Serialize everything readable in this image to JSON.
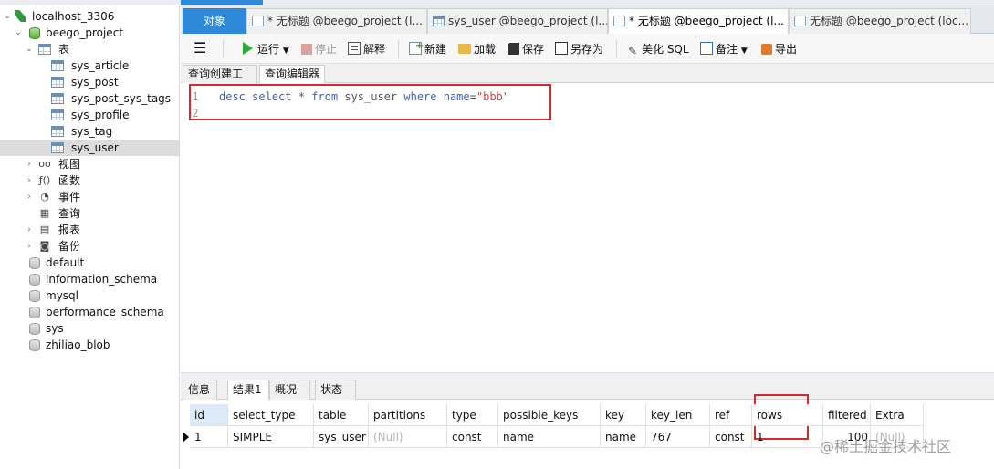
{
  "sidebar": {
    "connection": "localhost_3306",
    "database": "beego_project",
    "tables_folder": "表",
    "tables": [
      "sys_article",
      "sys_post",
      "sys_post_sys_tags",
      "sys_profile",
      "sys_tag",
      "sys_user"
    ],
    "selected_table": "sys_user",
    "folders": [
      "视图",
      "函数",
      "事件",
      "查询",
      "报表",
      "备份"
    ],
    "other_databases": [
      "default",
      "information_schema",
      "mysql",
      "performance_schema",
      "sys",
      "zhiliao_blob"
    ]
  },
  "tabs": [
    {
      "label": "对象",
      "icon": "objects"
    },
    {
      "label": "* 无标题 @beego_project (l...",
      "icon": "query-icon"
    },
    {
      "label": "sys_user @beego_project (l...",
      "icon": "table-icon"
    },
    {
      "label": "* 无标题 @beego_project (l...",
      "icon": "query-icon"
    },
    {
      "label": "无标题 @beego_project (loc...",
      "icon": "query-icon"
    }
  ],
  "toolbar": {
    "run": "运行",
    "stop": "停止",
    "explain": "解释",
    "new": "新建",
    "load": "加载",
    "save": "保存",
    "save_as": "另存为",
    "beautify": "美化 SQL",
    "snippet": "备注",
    "export": "导出"
  },
  "editor_tabs": [
    "查询创建工具",
    "查询编辑器"
  ],
  "editor": {
    "line_numbers": [
      "1",
      "2"
    ],
    "tokens": [
      {
        "t": "desc",
        "c": "kw"
      },
      {
        "t": " "
      },
      {
        "t": "select",
        "c": "kw"
      },
      {
        "t": " "
      },
      {
        "t": "*",
        "c": "op"
      },
      {
        "t": " "
      },
      {
        "t": "from",
        "c": "kw"
      },
      {
        "t": " "
      },
      {
        "t": "sys_user",
        "c": "id"
      },
      {
        "t": " "
      },
      {
        "t": "where",
        "c": "kw"
      },
      {
        "t": " "
      },
      {
        "t": "name",
        "c": "kw"
      },
      {
        "t": "=",
        "c": "op"
      },
      {
        "t": "\"bbb\"",
        "c": "str"
      }
    ]
  },
  "result_tabs": [
    "信息",
    "结果1",
    "概况",
    "状态"
  ],
  "active_result_tab": "结果1",
  "grid": {
    "columns": [
      "id",
      "select_type",
      "table",
      "partitions",
      "type",
      "possible_keys",
      "key",
      "key_len",
      "ref",
      "rows",
      "filtered",
      "Extra"
    ],
    "rows": [
      [
        "1",
        "SIMPLE",
        "sys_user",
        "(Null)",
        "const",
        "name",
        "name",
        "767",
        "const",
        "1",
        "100",
        "(Null)"
      ]
    ]
  },
  "watermark": "@稀土掘金技术社区",
  "colors": {
    "accent": "#2f89d9",
    "highlight_box": "#d9272e",
    "keyword": "#3d5fc4",
    "string": "#d04040"
  }
}
